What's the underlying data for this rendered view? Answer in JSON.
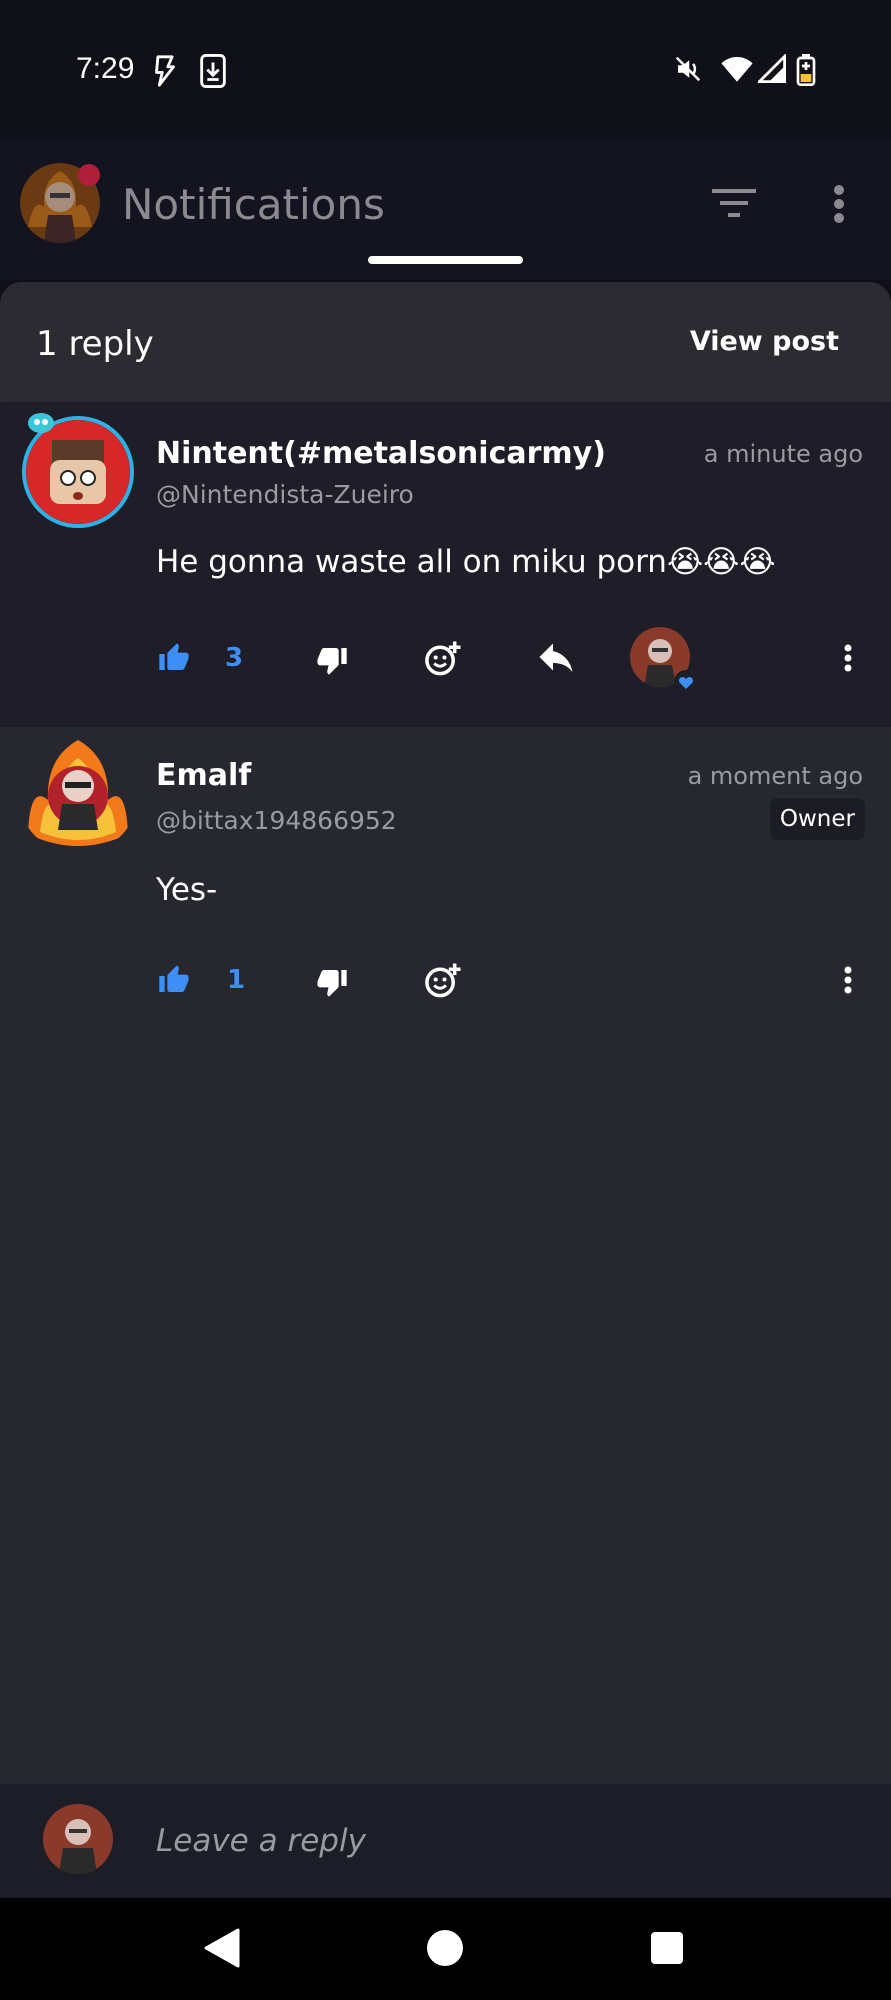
{
  "status_bar": {
    "time": "7:29",
    "icons": [
      "flash-icon",
      "download-icon",
      "mute-icon",
      "wifi-icon",
      "signal-icon",
      "battery-charging-icon"
    ]
  },
  "header": {
    "title": "Notifications",
    "icons": [
      "filter-icon",
      "more-vertical-icon"
    ]
  },
  "sheet": {
    "reply_count": "1 reply",
    "view_post_label": "View post"
  },
  "comments": [
    {
      "username": "Nintent(#metalsonicarmy)",
      "handle": "@Nintendista-Zueiro",
      "time": "a minute ago",
      "text": "He gonna waste all on miku porn😭😭😭",
      "likes": "3",
      "hearted": true
    },
    {
      "username": "Emalf",
      "handle": "@bittax194866952",
      "time": "a moment ago",
      "badge": "Owner",
      "text": "Yes-",
      "likes": "1"
    }
  ],
  "reply": {
    "placeholder": "Leave a reply"
  },
  "colors": {
    "accent_blue": "#3d8ef5",
    "sheet_bg": "#27272f",
    "op_comment_bg": "#1e1d28",
    "status_bg": "#101018"
  }
}
